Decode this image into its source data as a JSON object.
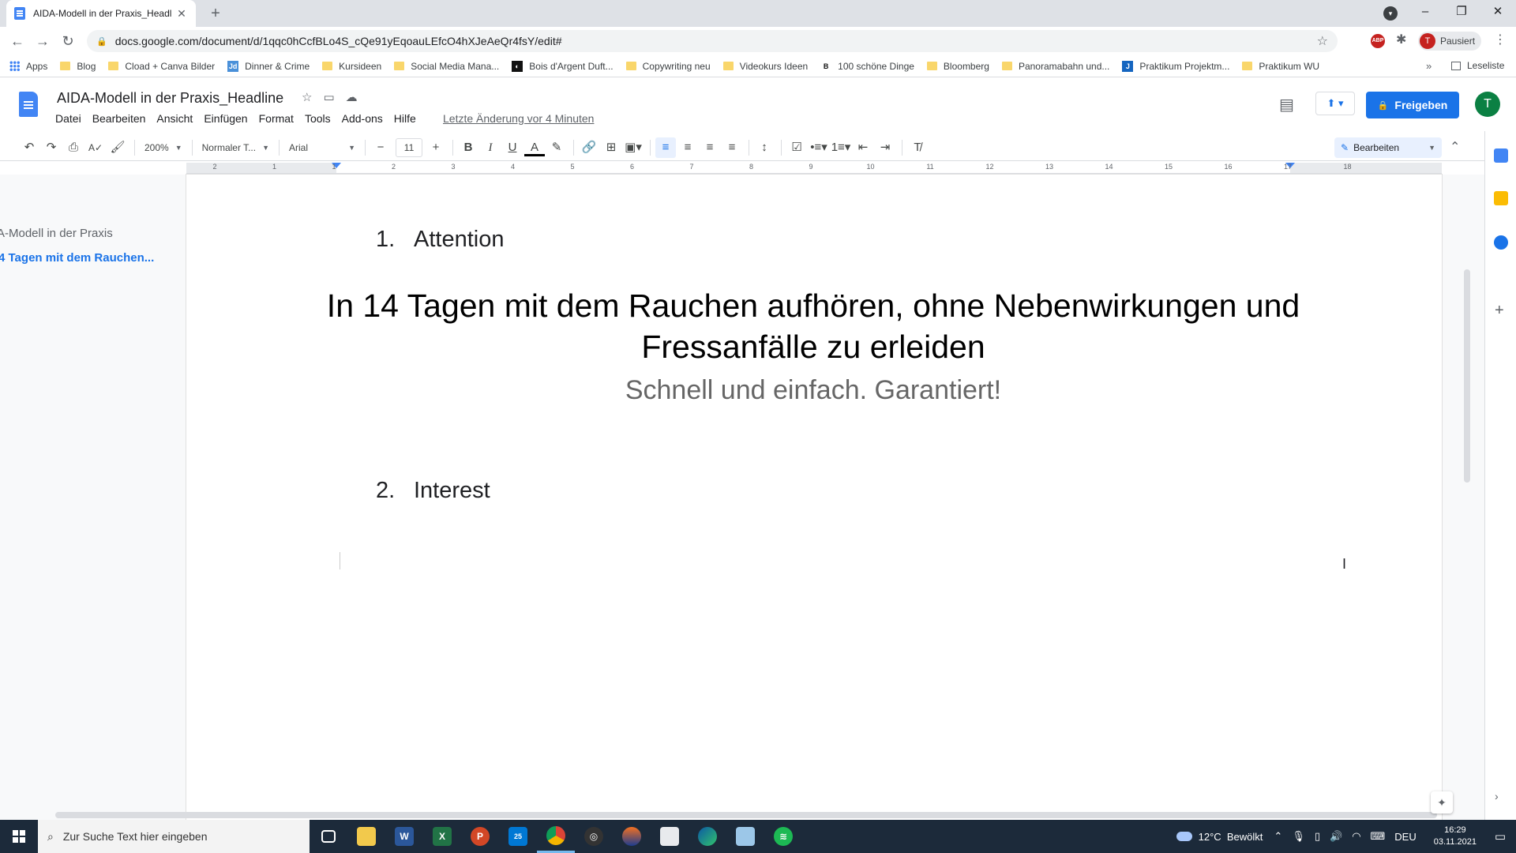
{
  "browser": {
    "tab_title": "AIDA-Modell in der Praxis_Headl",
    "url": "docs.google.com/document/d/1qqc0hCcfBLo4S_cQe91yEqoauLEfcO4hXJeAeQr4fsY/edit#",
    "profile_initial": "T",
    "profile_status": "Pausiert",
    "abp_label": "ABP"
  },
  "bookmarks": {
    "items": [
      {
        "label": "Apps",
        "icon": "apps-grid-icon"
      },
      {
        "label": "Blog",
        "icon": "folder-icon"
      },
      {
        "label": "Cload + Canva Bilder",
        "icon": "folder-icon"
      },
      {
        "label": "Dinner & Crime",
        "icon": "site-icon"
      },
      {
        "label": "Kursideen",
        "icon": "folder-icon"
      },
      {
        "label": "Social Media Mana...",
        "icon": "folder-icon"
      },
      {
        "label": "Bois d'Argent Duft...",
        "icon": "site-icon"
      },
      {
        "label": "Copywriting neu",
        "icon": "folder-icon"
      },
      {
        "label": "Videokurs Ideen",
        "icon": "folder-icon"
      },
      {
        "label": "100 schöne Dinge",
        "icon": "site-icon"
      },
      {
        "label": "Bloomberg",
        "icon": "folder-icon"
      },
      {
        "label": "Panoramabahn und...",
        "icon": "folder-icon"
      },
      {
        "label": "Praktikum Projektm...",
        "icon": "site-icon"
      },
      {
        "label": "Praktikum WU",
        "icon": "folder-icon"
      }
    ],
    "more": "»",
    "reading_list": "Leseliste"
  },
  "docs": {
    "title": "AIDA-Modell in der Praxis_Headline",
    "menu": [
      "Datei",
      "Bearbeiten",
      "Ansicht",
      "Einfügen",
      "Format",
      "Tools",
      "Add-ons",
      "Hilfe"
    ],
    "last_edit": "Letzte Änderung vor 4 Minuten",
    "share": "Freigeben",
    "account_initial": "T"
  },
  "toolbar": {
    "zoom": "200%",
    "style": "Normaler T...",
    "font": "Arial",
    "font_size": "11",
    "mode": "Bearbeiten"
  },
  "ruler": {
    "numbers": [
      "2",
      "1",
      "1",
      "2",
      "3",
      "4",
      "5",
      "6",
      "7",
      "8",
      "9",
      "10",
      "11",
      "12",
      "13",
      "14",
      "15",
      "16",
      "17",
      "18"
    ]
  },
  "outline": {
    "items": [
      "A-Modell in der Praxis",
      "4 Tagen mit dem Rauchen..."
    ]
  },
  "document": {
    "heading1_number": "1.",
    "heading1_text": "Attention",
    "headline": "In 14 Tagen mit dem Rauchen aufhören, ohne Nebenwirkungen und Fressanfälle zu erleiden",
    "subheadline": "Schnell und einfach. Garantiert!",
    "heading2_number": "2.",
    "heading2_text": "Interest"
  },
  "taskbar": {
    "search_placeholder": "Zur Suche Text hier eingeben",
    "outlook_badge": "25",
    "temperature": "12°C",
    "weather": "Bewölkt",
    "language": "DEU",
    "time": "16:29",
    "date": "03.11.2021"
  },
  "colors": {
    "accent": "#1a73e8",
    "docs_blue": "#4285f4",
    "avatar_green": "#0b8043",
    "taskbar": "#1c2a3a"
  }
}
